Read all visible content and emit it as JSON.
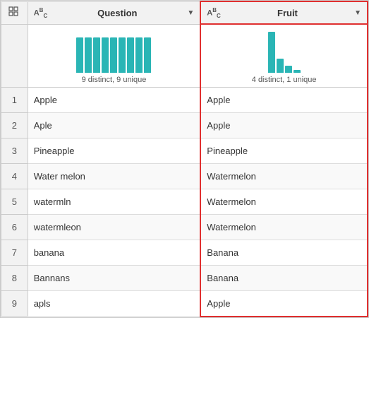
{
  "columns": {
    "index_header": "",
    "question": {
      "label": "Question",
      "type_icon": "ABC",
      "hist_label": "9 distinct, 9 unique",
      "bars": [
        50,
        50,
        50,
        50,
        50,
        50,
        50,
        50,
        50
      ]
    },
    "fruit": {
      "label": "Fruit",
      "type_icon": "ABC",
      "hist_label": "4 distinct, 1 unique",
      "bars": [
        58,
        14,
        6,
        2
      ]
    }
  },
  "rows": [
    {
      "index": 1,
      "question": "Apple",
      "fruit": "Apple"
    },
    {
      "index": 2,
      "question": "Aple",
      "fruit": "Apple"
    },
    {
      "index": 3,
      "question": "Pineapple",
      "fruit": "Pineapple"
    },
    {
      "index": 4,
      "question": "Water melon",
      "fruit": "Watermelon"
    },
    {
      "index": 5,
      "question": "watermln",
      "fruit": "Watermelon"
    },
    {
      "index": 6,
      "question": "watermleon",
      "fruit": "Watermelon"
    },
    {
      "index": 7,
      "question": "banana",
      "fruit": "Banana"
    },
    {
      "index": 8,
      "question": "Bannans",
      "fruit": "Banana"
    },
    {
      "index": 9,
      "question": "apls",
      "fruit": "Apple"
    }
  ],
  "icons": {
    "grid": "⊞",
    "abc_type": "A",
    "dropdown": "▼"
  }
}
